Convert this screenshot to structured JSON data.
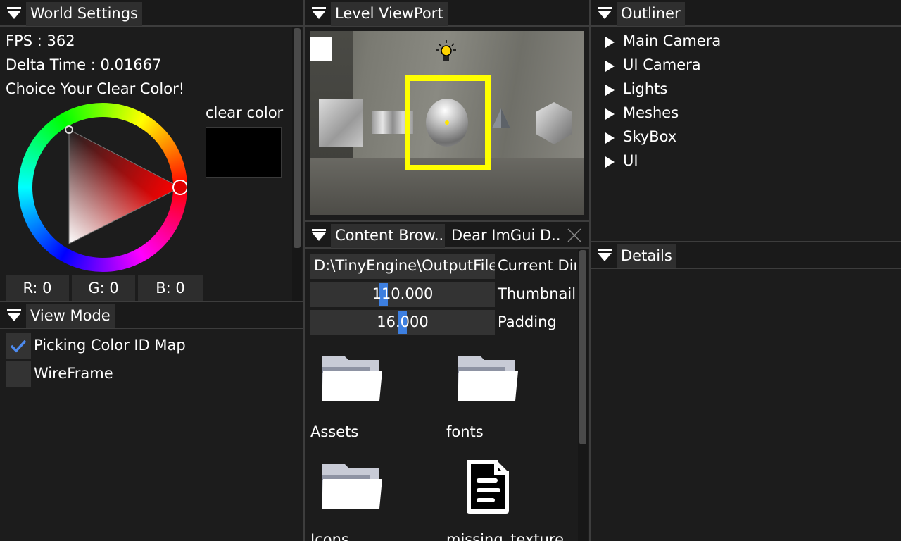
{
  "world_settings": {
    "tab_title": "World Settings",
    "fps": "FPS : 362",
    "delta_time": "Delta Time : 0.01667",
    "prompt": "Choice Your Clear Color!",
    "clear_color_label": "clear color",
    "clear_color": "#000000",
    "r_label": "R:  0",
    "g_label": "G:  0",
    "b_label": "B:  0"
  },
  "view_mode": {
    "tab_title": "View Mode",
    "options": [
      {
        "label": "Picking Color ID Map",
        "checked": true
      },
      {
        "label": "WireFrame",
        "checked": false
      }
    ]
  },
  "viewport": {
    "tab_title": "Level ViewPort",
    "selection_color": "#ffff00"
  },
  "content_browser": {
    "tab_title": "Content Brow...",
    "tab2_title": "Dear ImGui D...",
    "current_dir_value": "D:\\TinyEngine\\OutputFile",
    "current_dir_label": "Current Dir",
    "thumbnail_value": "110.000",
    "thumbnail_label": "Thumbnail",
    "padding_value": "16.000",
    "padding_label": "Padding",
    "items": [
      {
        "name": "Assets",
        "icon": "folder-icon"
      },
      {
        "name": "fonts",
        "icon": "folder-icon"
      },
      {
        "name": "Icons",
        "icon": "folder-icon"
      },
      {
        "name": "missing_texture",
        "icon": "file-icon"
      }
    ]
  },
  "outliner": {
    "tab_title": "Outliner",
    "items": [
      "Main Camera",
      "UI Camera",
      "Lights",
      "Meshes",
      "SkyBox",
      "UI"
    ]
  },
  "details": {
    "tab_title": "Details"
  }
}
